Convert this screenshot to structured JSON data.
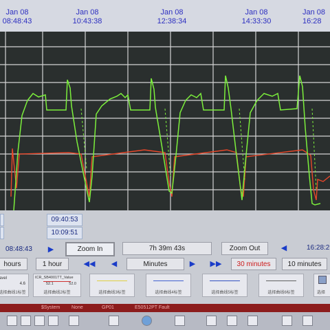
{
  "time_header": [
    {
      "date": "Jan 08",
      "time": "08:48:43"
    },
    {
      "date": "Jan 08",
      "time": "10:43:38"
    },
    {
      "date": "Jan 08",
      "time": "12:38:34"
    },
    {
      "date": "Jan 08",
      "time": "14:33:30"
    },
    {
      "date": "Jan 08",
      "time": "16:28"
    }
  ],
  "cursor_times": {
    "t1": "09:40:53",
    "t2": "10:09:51"
  },
  "nav": {
    "start": "08:48:43",
    "zoom_in": "Zoom In",
    "span": "7h 39m 43s",
    "zoom_out": "Zoom Out",
    "end": "16:28:26"
  },
  "units": {
    "hours": "hours",
    "one_hour": "1 hour",
    "minutes": "Minutes",
    "thirty_min": "30 minutes",
    "ten_min": "10 minutes"
  },
  "pens": [
    {
      "name": "avel",
      "value": "4.6",
      "caption": "选择曲线1标签",
      "color": "#40a040"
    },
    {
      "name": "ICR_SB4001TT_Value",
      "value_a": "52.1",
      "value_b": "52.0",
      "caption": "选择曲线2标签",
      "color": "#d03030"
    },
    {
      "caption": "选择曲线3标签",
      "color": "#e0d040"
    },
    {
      "caption": "选择曲线4标签",
      "color": "#4060d0"
    },
    {
      "caption": "选择曲线5标签",
      "color": "#3050c0"
    },
    {
      "caption": "选择曲线6标签",
      "color": "#606060"
    },
    {
      "caption": "选择",
      "color": "#808080"
    }
  ],
  "alarm": {
    "system": "$System",
    "none": "None",
    "gp": "GP01",
    "fault": "E50512PT Fault"
  },
  "colors": {
    "green": "#7cf03c",
    "red": "#e8472a",
    "grid": "#e8e8e8",
    "header_text": "#2d2fc0"
  }
}
